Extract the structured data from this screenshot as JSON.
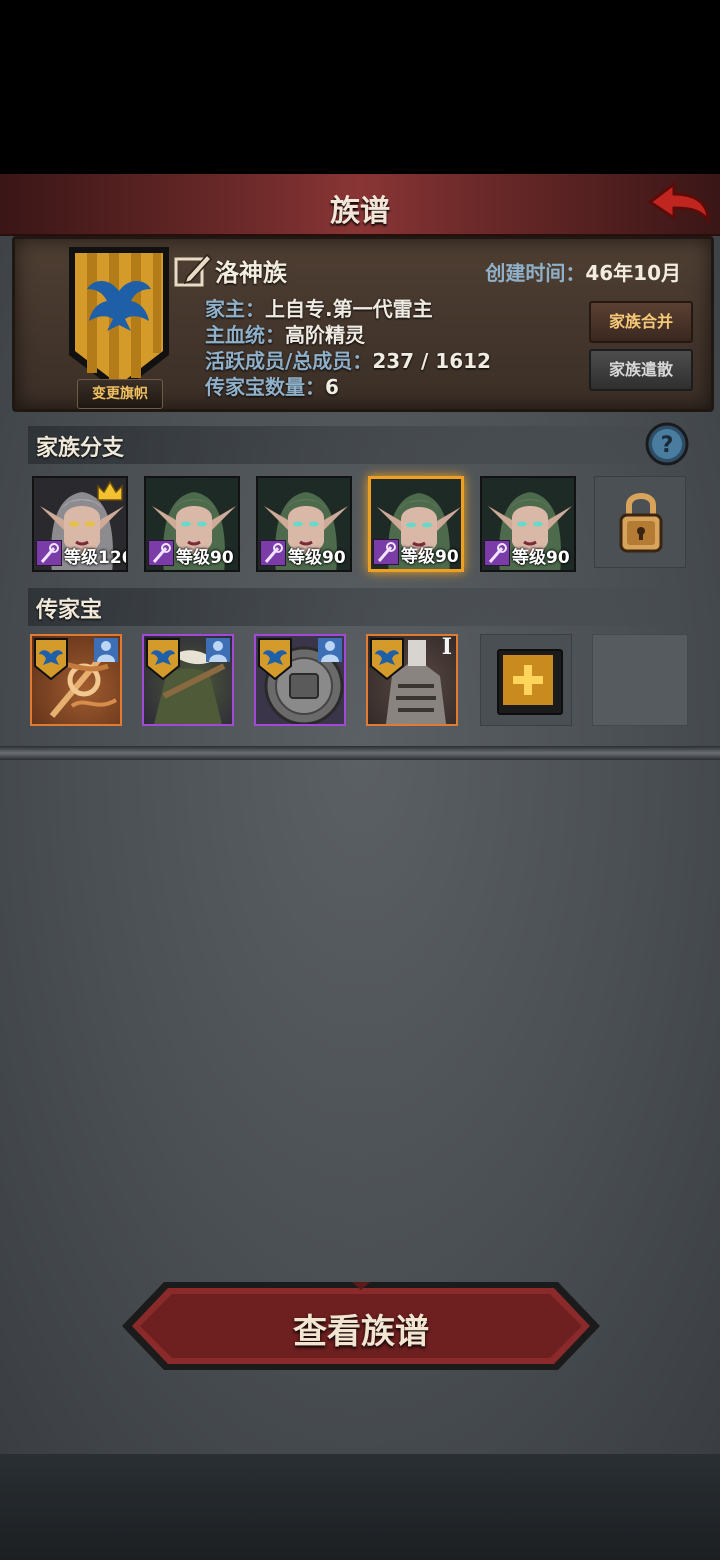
{
  "header": {
    "title": "族谱"
  },
  "family": {
    "change_banner_label": "变更旗帜",
    "name": "洛神族",
    "created_label": "创建时间：",
    "created_value": "46年10月",
    "head_label": "家主：",
    "head_value": "上自专.第一代雷主",
    "bloodline_label": "主血统：",
    "bloodline_value": "高阶精灵",
    "members_label": "活跃成员/总成员：",
    "members_value": "237 / 1612",
    "treasure_count_label": "传家宝数量：",
    "treasure_count_value": "6",
    "merge_label": "家族合并",
    "dissolve_label": "家族遣散"
  },
  "branches": {
    "title": "家族分支",
    "items": [
      {
        "level": "等级126",
        "leader": true,
        "selected": false
      },
      {
        "level": "等级90",
        "leader": false,
        "selected": false
      },
      {
        "level": "等级90",
        "leader": false,
        "selected": false
      },
      {
        "level": "等级90",
        "leader": false,
        "selected": true
      },
      {
        "level": "等级90",
        "leader": false,
        "selected": false
      }
    ]
  },
  "heirlooms": {
    "title": "传家宝",
    "tier_mark": "I"
  },
  "footer": {
    "view_label": "查看族谱"
  },
  "colors": {
    "accent": "#f0a020",
    "orange_rarity": "#e07b34",
    "purple_rarity": "#a24ad8",
    "banner_gold": "#d49a2a",
    "banner_bird": "#1f5fa8"
  }
}
